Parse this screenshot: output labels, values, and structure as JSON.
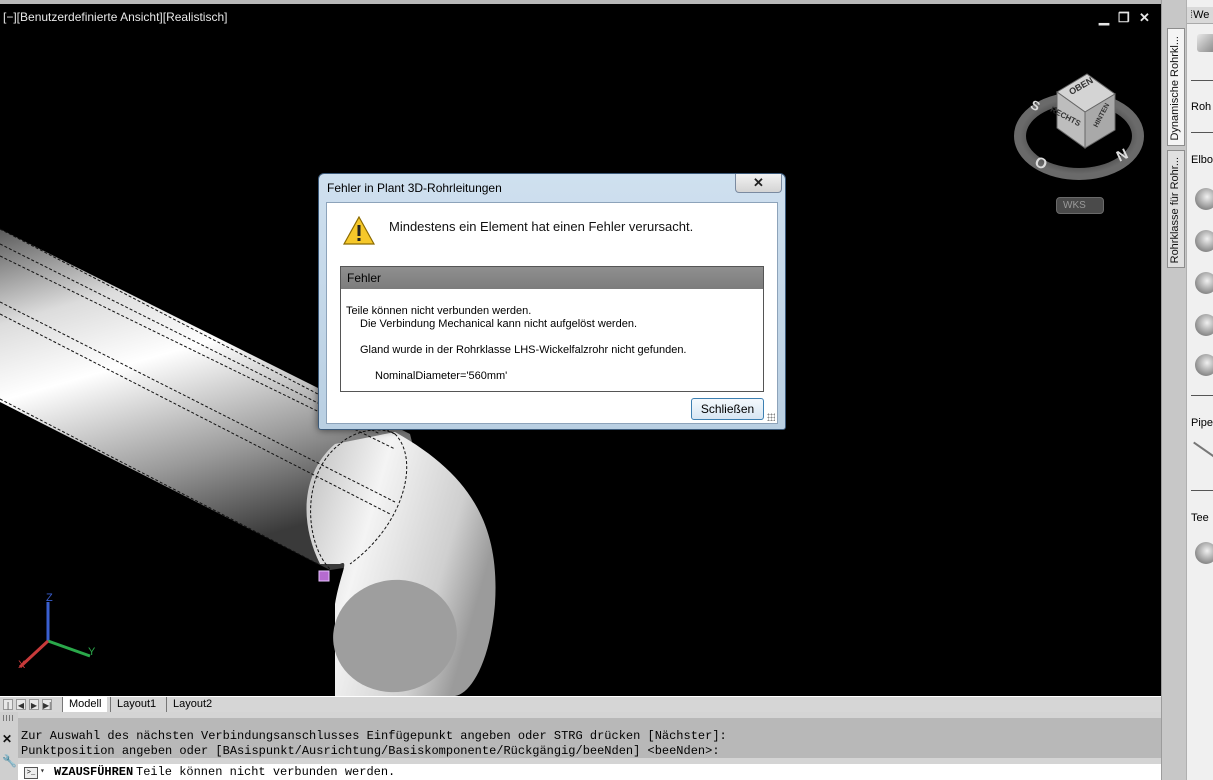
{
  "viewport": {
    "label": "[−][Benutzerdefinierte Ansicht][Realistisch]",
    "controls": {
      "minimize": "▁",
      "restore": "❐",
      "close": "✕"
    },
    "viewcube": {
      "faces": {
        "top": "OBEN",
        "front": "RECHTS",
        "side": "HINTEN"
      },
      "compass": {
        "north": "N",
        "south": "S",
        "east": "O"
      },
      "wcs_label": "WKS"
    },
    "ucs": {
      "x": "X",
      "y": "Y",
      "z": "Z"
    }
  },
  "layout_tabs": {
    "nav": [
      "|◀",
      "◀",
      "▶",
      "▶|"
    ],
    "tabs": [
      {
        "label": "Modell",
        "active": true
      },
      {
        "label": "Layout1",
        "active": false
      },
      {
        "label": "Layout2",
        "active": false
      }
    ]
  },
  "command": {
    "close_icon": "✕",
    "history": [
      "Zur Auswahl des nächsten Verbindungsanschlusses Einfügepunkt angeben oder STRG drücken [Nächster]:",
      "Punktposition angeben oder [BAsispunkt/Ausrichtung/Basiskomponente/Rückgängig/beeNden] <beeNden>:"
    ],
    "prompt_icon": ">_",
    "dropdown": "▾",
    "command_name": "WZAUSFÜHREN",
    "input_text": "Teile können nicht verbunden werden."
  },
  "right_panel": {
    "vertical_tabs": [
      "Dynamische Rohrkl...",
      "Rohrklasse für Rohr..."
    ],
    "palette_title": "We",
    "labels": [
      "Roh",
      "Elbo",
      "Pipe",
      "Tee"
    ]
  },
  "dialog": {
    "title": "Fehler in Plant 3D-Rohrleitungen",
    "close_glyph": "✕",
    "message": "Mindestens ein Element hat einen Fehler verursacht.",
    "error_header": "Fehler",
    "error_lines": [
      "Teile können nicht verbunden werden.",
      "Die Verbindung Mechanical kann nicht aufgelöst werden.",
      "Gland wurde in der Rohrklasse LHS-Wickelfalzrohr nicht gefunden.",
      "NominalDiameter='560mm'"
    ],
    "button_label": "Schließen"
  }
}
